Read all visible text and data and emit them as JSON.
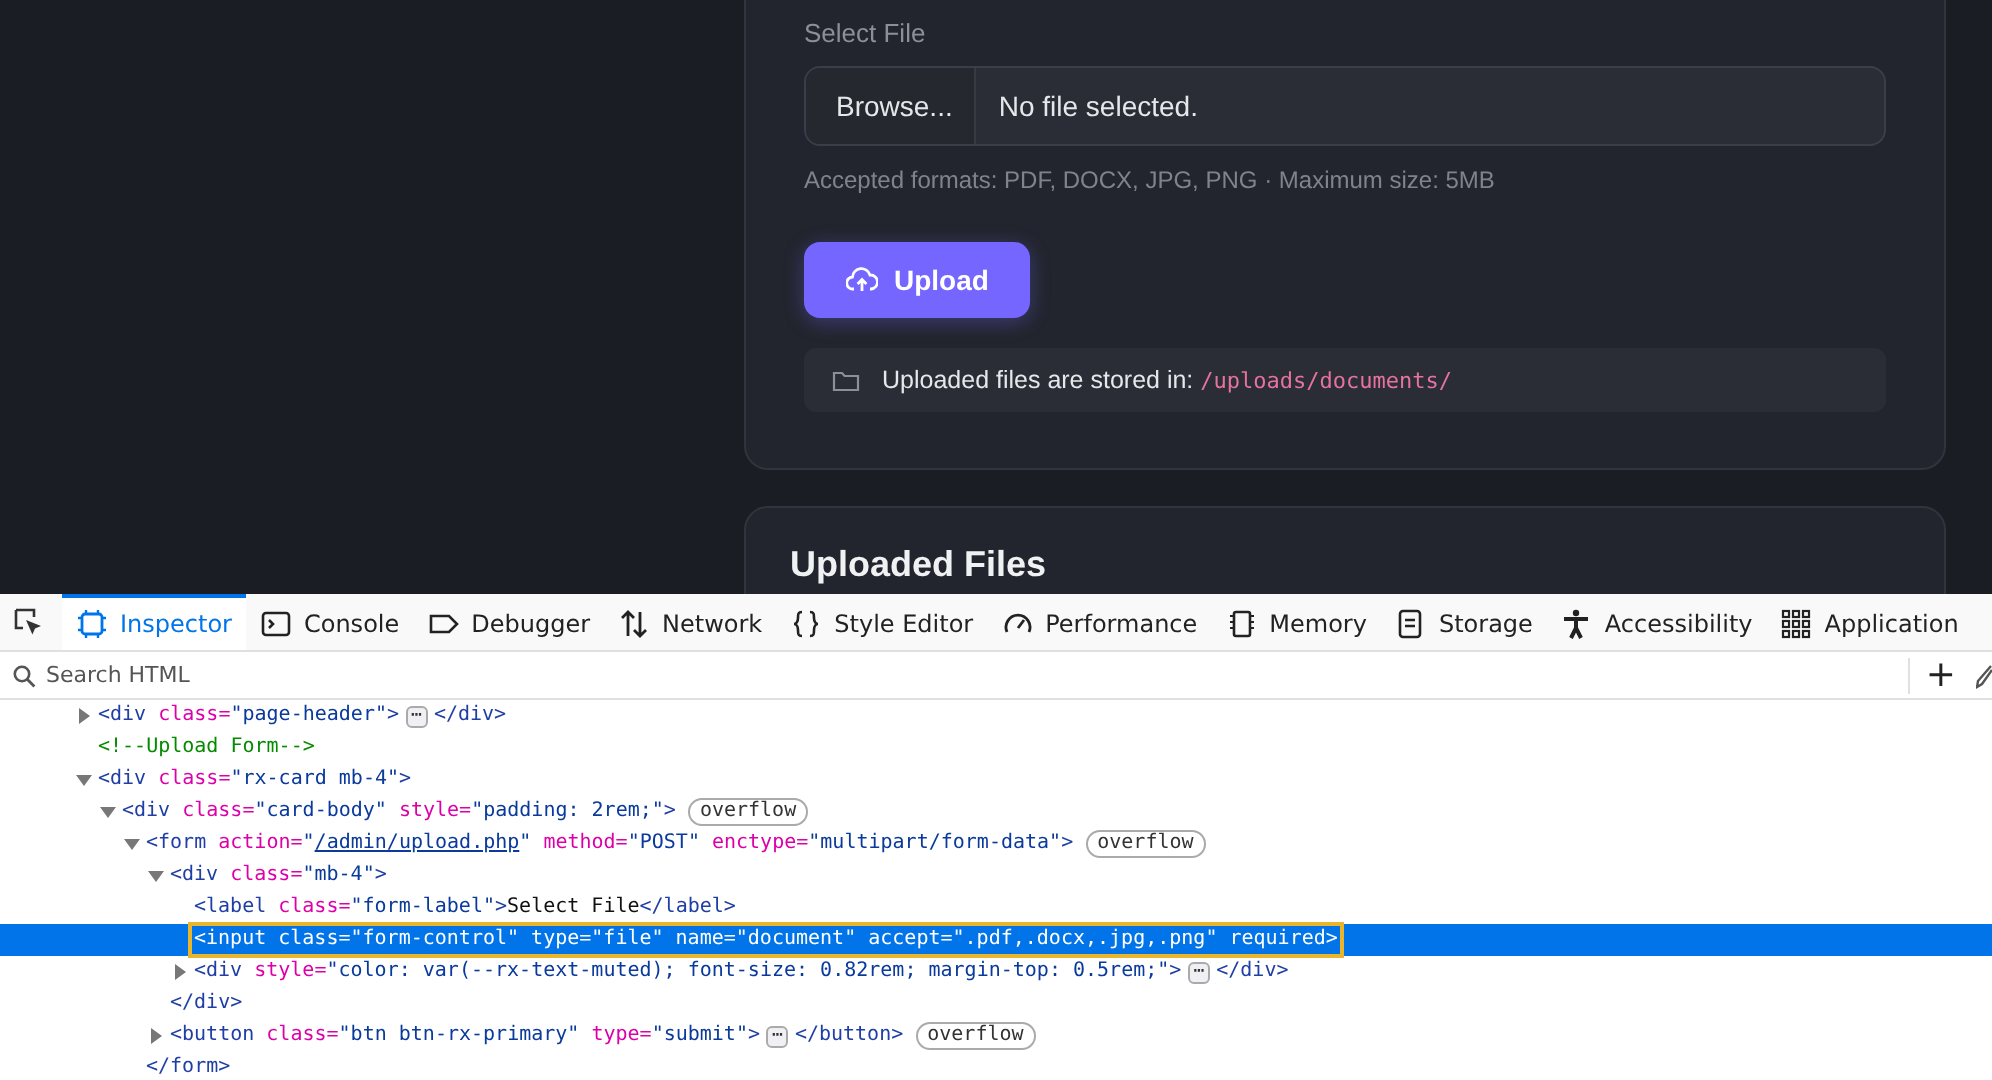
{
  "page": {
    "upload_card": {
      "label": "Select File",
      "file_input": {
        "button": "Browse...",
        "value": "No file selected."
      },
      "hint": "Accepted formats: PDF, DOCX, JPG, PNG · Maximum size: 5MB",
      "submit": "Upload",
      "storage_note": {
        "text": "Uploaded files are stored in:",
        "path": "/uploads/documents/"
      }
    },
    "files_card": {
      "title": "Uploaded Files"
    }
  },
  "devtools": {
    "tabs": [
      {
        "label": "Inspector",
        "selected": true
      },
      {
        "label": "Console",
        "selected": false
      },
      {
        "label": "Debugger",
        "selected": false
      },
      {
        "label": "Network",
        "selected": false
      },
      {
        "label": "Style Editor",
        "selected": false
      },
      {
        "label": "Performance",
        "selected": false
      },
      {
        "label": "Memory",
        "selected": false
      },
      {
        "label": "Storage",
        "selected": false
      },
      {
        "label": "Accessibility",
        "selected": false
      },
      {
        "label": "Application",
        "selected": false
      }
    ],
    "search": {
      "placeholder": "Search HTML"
    },
    "add_button": "+",
    "tree": [
      {
        "expanded": false,
        "selected": false,
        "tokens": [
          {
            "kind": "tag",
            "text": "<div"
          },
          {
            "kind": "attr",
            "text": "class="
          },
          {
            "kind": "value",
            "text": "\"page-header\""
          },
          {
            "kind": "tag",
            "text": ">"
          },
          {
            "kind": "more",
            "text": "⋯"
          },
          {
            "kind": "tag",
            "text": "</div>"
          }
        ]
      },
      {
        "selected": false,
        "tokens": [
          {
            "kind": "comment",
            "text": "<!--Upload Form-->"
          }
        ]
      },
      {
        "expanded": true,
        "selected": false,
        "tokens": [
          {
            "kind": "tag",
            "text": "<div"
          },
          {
            "kind": "attr",
            "text": "class="
          },
          {
            "kind": "value",
            "text": "\"rx-card mb-4\""
          },
          {
            "kind": "tag",
            "text": ">"
          }
        ],
        "children": [
          {
            "expanded": true,
            "selected": false,
            "tokens": [
              {
                "kind": "tag",
                "text": "<div"
              },
              {
                "kind": "attr",
                "text": "class="
              },
              {
                "kind": "value",
                "text": "\"card-body\""
              },
              {
                "kind": "attr",
                "text": "style="
              },
              {
                "kind": "value",
                "text": "\"padding: 2rem;\""
              },
              {
                "kind": "tag",
                "text": ">"
              },
              {
                "kind": "pill",
                "text": "overflow"
              }
            ],
            "children": [
              {
                "expanded": true,
                "selected": false,
                "tokens": [
                  {
                    "kind": "tag",
                    "text": "<form"
                  },
                  {
                    "kind": "attr",
                    "text": "action="
                  },
                  {
                    "kind": "value",
                    "text": "\""
                  },
                  {
                    "kind": "link",
                    "text": "/admin/upload.php"
                  },
                  {
                    "kind": "value",
                    "text": "\""
                  },
                  {
                    "kind": "attr",
                    "text": "method="
                  },
                  {
                    "kind": "value",
                    "text": "\"POST\""
                  },
                  {
                    "kind": "attr",
                    "text": "enctype="
                  },
                  {
                    "kind": "value",
                    "text": "\"multipart/form-data\""
                  },
                  {
                    "kind": "tag",
                    "text": ">"
                  },
                  {
                    "kind": "pill",
                    "text": "overflow"
                  }
                ],
                "closing": [
                  {
                    "kind": "tag",
                    "text": "</form>"
                  }
                ],
                "children": [
                  {
                    "expanded": true,
                    "selected": false,
                    "tokens": [
                      {
                        "kind": "tag",
                        "text": "<div"
                      },
                      {
                        "kind": "attr",
                        "text": "class="
                      },
                      {
                        "kind": "value",
                        "text": "\"mb-4\""
                      },
                      {
                        "kind": "tag",
                        "text": ">"
                      }
                    ],
                    "closing": [
                      {
                        "kind": "tag",
                        "text": "</div>"
                      }
                    ],
                    "children": [
                      {
                        "selected": false,
                        "tokens": [
                          {
                            "kind": "tag",
                            "text": "<label"
                          },
                          {
                            "kind": "attr",
                            "text": "class="
                          },
                          {
                            "kind": "value",
                            "text": "\"form-label\""
                          },
                          {
                            "kind": "tag",
                            "text": ">"
                          },
                          {
                            "kind": "text",
                            "text": "Select File"
                          },
                          {
                            "kind": "tag",
                            "text": "</label>"
                          }
                        ]
                      },
                      {
                        "selected": true,
                        "hovered": true,
                        "tokens": [
                          {
                            "kind": "tag",
                            "text": "<input"
                          },
                          {
                            "kind": "attr",
                            "text": "class="
                          },
                          {
                            "kind": "value",
                            "text": "\"form-control\""
                          },
                          {
                            "kind": "attr",
                            "text": "type="
                          },
                          {
                            "kind": "value",
                            "text": "\"file\""
                          },
                          {
                            "kind": "attr",
                            "text": "name="
                          },
                          {
                            "kind": "value",
                            "text": "\"document\""
                          },
                          {
                            "kind": "attr",
                            "text": "accept="
                          },
                          {
                            "kind": "value",
                            "text": "\".pdf,.docx,.jpg,.png\""
                          },
                          {
                            "kind": "attr",
                            "text": "required"
                          },
                          {
                            "kind": "tag",
                            "text": ">"
                          }
                        ]
                      },
                      {
                        "expanded": false,
                        "selected": false,
                        "tokens": [
                          {
                            "kind": "tag",
                            "text": "<div"
                          },
                          {
                            "kind": "attr",
                            "text": "style="
                          },
                          {
                            "kind": "value",
                            "text": "\"color: var(--rx-text-muted); font-size: 0.82rem; margin-top: 0.5rem;\""
                          },
                          {
                            "kind": "tag",
                            "text": ">"
                          },
                          {
                            "kind": "more",
                            "text": "⋯"
                          },
                          {
                            "kind": "tag",
                            "text": "</div>"
                          }
                        ]
                      }
                    ]
                  },
                  {
                    "expanded": false,
                    "selected": false,
                    "tokens": [
                      {
                        "kind": "tag",
                        "text": "<button"
                      },
                      {
                        "kind": "attr",
                        "text": "class="
                      },
                      {
                        "kind": "value",
                        "text": "\"btn btn-rx-primary\""
                      },
                      {
                        "kind": "attr",
                        "text": "type="
                      },
                      {
                        "kind": "value",
                        "text": "\"submit\""
                      },
                      {
                        "kind": "tag",
                        "text": ">"
                      },
                      {
                        "kind": "more",
                        "text": "⋯"
                      },
                      {
                        "kind": "tag",
                        "text": "</button>"
                      },
                      {
                        "kind": "pill",
                        "text": "overflow"
                      }
                    ]
                  }
                ]
              }
            ]
          }
        ]
      }
    ]
  }
}
